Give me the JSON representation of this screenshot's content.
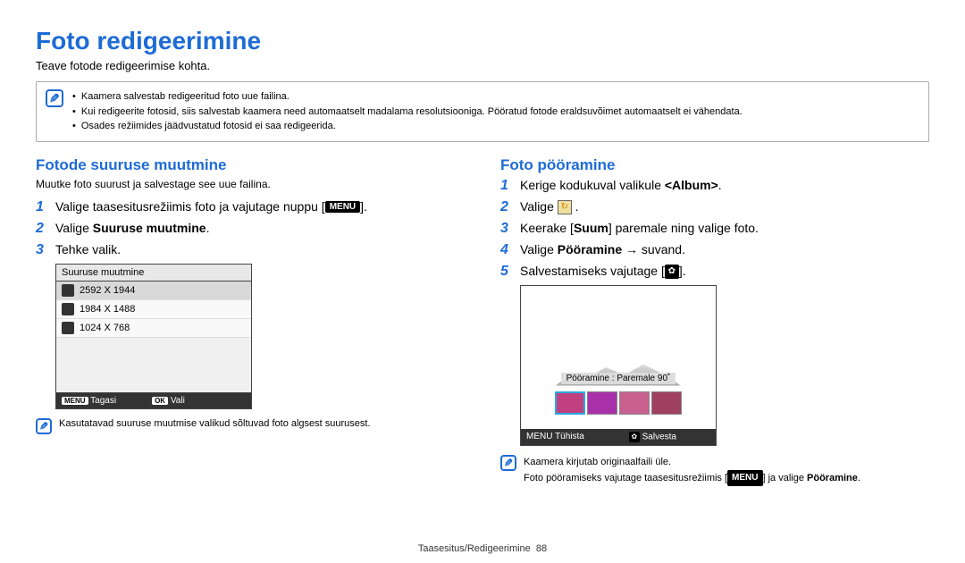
{
  "page": {
    "title": "Foto redigeerimine",
    "subtitle": "Teave fotode redigeerimise kohta."
  },
  "top_note": {
    "lines": [
      "Kaamera salvestab redigeeritud foto uue failina.",
      "Kui redigeerite fotosid, siis salvestab kaamera need automaatselt madalama resolutsiooniga. Pööratud fotode eraldsuvõimet automaatselt ei vähendata.",
      "Osades režiimides jäädvustatud fotosid ei saa redigeerida."
    ]
  },
  "left": {
    "heading": "Fotode suuruse muutmine",
    "sub": "Muutke foto suurust ja salvestage see uue failina.",
    "steps": {
      "s1_a": "Valige taasesitusrežiimis foto ja vajutage nuppu [",
      "s1_b": "].",
      "s2_a": "Valige ",
      "s2_b": "Suuruse muutmine",
      "s2_c": ".",
      "s3": "Tehke valik."
    },
    "ui": {
      "header": "Suuruse muutmine",
      "rows": [
        "2592 X 1944",
        "1984 X 1488",
        "1024 X 768"
      ],
      "footer_back": "Tagasi",
      "footer_select": "Vali"
    },
    "note": "Kasutatavad suuruse muutmise valikud sõltuvad foto algsest suurusest."
  },
  "right": {
    "heading": "Foto pööramine",
    "steps": {
      "s1_a": "Kerige kodukuval valikule ",
      "s1_b": "<Album>",
      "s1_c": ".",
      "s2": "Valige ",
      "s3_a": "Keerake [",
      "s3_b": "Suum",
      "s3_c": "] paremale ning valige foto.",
      "s4_a": "Valige ",
      "s4_b": "Pööramine",
      "s4_c": " → suvand.",
      "s5_a": "Salvestamiseks vajutage [",
      "s5_b": "]."
    },
    "ui": {
      "caption": "Pööramine : Paremale 90˚",
      "footer_cancel": "Tühista",
      "footer_save": "Salvesta"
    },
    "note": {
      "l1": "Kaamera kirjutab originaalfaili üle.",
      "l2_a": "Foto pööramiseks vajutage taasesitusrežiimis [",
      "l2_b": "] ja valige ",
      "l2_c": "Pööramine",
      "l2_d": "."
    }
  },
  "menu_label": "MENU",
  "ok_label": "OK",
  "footer": {
    "section": "Taasesitus/Redigeerimine",
    "page": "88"
  }
}
